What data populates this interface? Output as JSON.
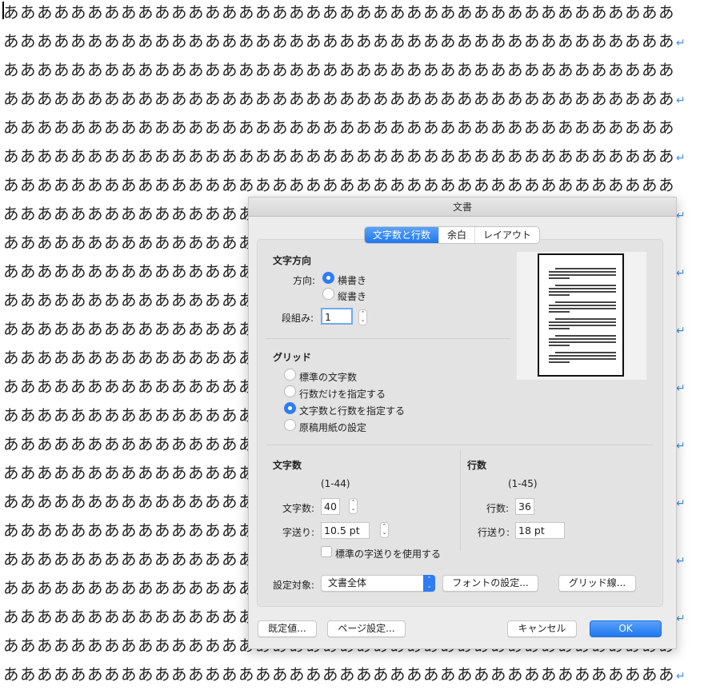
{
  "document": {
    "line_text": "ああああああああああああああああああああああああああああああああああああああああ",
    "line_count": 24,
    "return_mark": "↵"
  },
  "dialog": {
    "title": "文書",
    "tabs": [
      {
        "label": "文字数と行数",
        "active": true
      },
      {
        "label": "余白",
        "active": false
      },
      {
        "label": "レイアウト",
        "active": false
      }
    ],
    "text_direction": {
      "heading": "文字方向",
      "direction_label": "方向:",
      "options": [
        "横書き",
        "縦書き"
      ],
      "columns_label": "段組み:",
      "columns_value": "1"
    },
    "grid": {
      "heading": "グリッド",
      "options": [
        "標準の文字数",
        "行数だけを指定する",
        "文字数と行数を指定する",
        "原稿用紙の設定"
      ],
      "selected_index": 2
    },
    "chars": {
      "heading": "文字数",
      "range": "(1-44)",
      "count_label": "文字数:",
      "count_value": "40",
      "pitch_label": "字送り:",
      "pitch_value": "10.5 pt",
      "default_pitch_label": "標準の字送りを使用する"
    },
    "lines": {
      "heading": "行数",
      "range": "(1-45)",
      "count_label": "行数:",
      "count_value": "36",
      "pitch_label": "行送り:",
      "pitch_value": "18 pt"
    },
    "apply_to_label": "設定対象:",
    "apply_to_value": "文書全体",
    "font_settings_button": "フォントの設定...",
    "grid_lines_button": "グリッド線...",
    "default_button": "既定値...",
    "page_setup_button": "ページ設定...",
    "cancel_button": "キャンセル",
    "ok_button": "OK"
  }
}
